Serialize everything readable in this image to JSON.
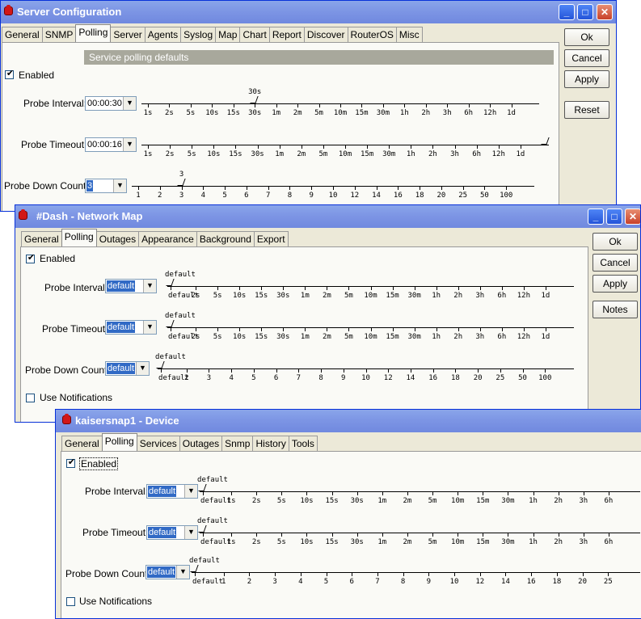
{
  "win1": {
    "title": "Server Configuration",
    "tabs": [
      "General",
      "SNMP",
      "Polling",
      "Server",
      "Agents",
      "Syslog",
      "Map",
      "Chart",
      "Report",
      "Discover",
      "RouterOS",
      "Misc"
    ],
    "active_tab": "Polling",
    "section": "Service polling defaults",
    "enabled_label": "Enabled",
    "buttons": {
      "ok": "Ok",
      "cancel": "Cancel",
      "apply": "Apply",
      "reset": "Reset"
    },
    "probe_interval": {
      "label": "Probe Interval:",
      "value": "00:00:30",
      "marker": "30s",
      "ticks": [
        "1s",
        "2s",
        "5s",
        "10s",
        "15s",
        "30s",
        "1m",
        "2m",
        "5m",
        "10m",
        "15m",
        "30m",
        "1h",
        "2h",
        "3h",
        "6h",
        "12h",
        "1d"
      ]
    },
    "probe_timeout": {
      "label": "Probe Timeout:",
      "value": "00:00:16",
      "ticks": [
        "1s",
        "2s",
        "5s",
        "10s",
        "15s",
        "30s",
        "1m",
        "2m",
        "5m",
        "10m",
        "15m",
        "30m",
        "1h",
        "2h",
        "3h",
        "6h",
        "12h",
        "1d"
      ]
    },
    "probe_down": {
      "label": "Probe Down Count:",
      "value": "3",
      "marker": "3",
      "ticks": [
        "1",
        "2",
        "3",
        "4",
        "5",
        "6",
        "7",
        "8",
        "9",
        "10",
        "12",
        "14",
        "16",
        "18",
        "20",
        "25",
        "50",
        "100"
      ]
    }
  },
  "win2": {
    "title": "#Dash - Network Map",
    "tabs": [
      "General",
      "Polling",
      "Outages",
      "Appearance",
      "Background",
      "Export"
    ],
    "active_tab": "Polling",
    "enabled_label": "Enabled",
    "use_notifications": "Use Notifications",
    "buttons": {
      "ok": "Ok",
      "cancel": "Cancel",
      "apply": "Apply",
      "notes": "Notes"
    },
    "probe_interval": {
      "label": "Probe Interval:",
      "value": "default",
      "marker": "default",
      "ticks": [
        "default",
        "2s",
        "5s",
        "10s",
        "15s",
        "30s",
        "1m",
        "2m",
        "5m",
        "10m",
        "15m",
        "30m",
        "1h",
        "2h",
        "3h",
        "6h",
        "12h",
        "1d"
      ]
    },
    "probe_timeout": {
      "label": "Probe Timeout:",
      "value": "default",
      "marker": "default",
      "ticks": [
        "default",
        "2s",
        "5s",
        "10s",
        "15s",
        "30s",
        "1m",
        "2m",
        "5m",
        "10m",
        "15m",
        "30m",
        "1h",
        "2h",
        "3h",
        "6h",
        "12h",
        "1d"
      ]
    },
    "probe_down": {
      "label": "Probe Down Count:",
      "value": "default",
      "marker": "default",
      "ticks": [
        "default",
        "2",
        "3",
        "4",
        "5",
        "6",
        "7",
        "8",
        "9",
        "10",
        "12",
        "14",
        "16",
        "18",
        "20",
        "25",
        "50",
        "100"
      ]
    }
  },
  "win3": {
    "title": "kaisersnap1 - Device",
    "tabs": [
      "General",
      "Polling",
      "Services",
      "Outages",
      "Snmp",
      "History",
      "Tools"
    ],
    "active_tab": "Polling",
    "enabled_label": "Enabled",
    "use_notifications": "Use Notifications",
    "probe_interval": {
      "label": "Probe Interval:",
      "value": "default",
      "marker": "default",
      "ticks": [
        "default",
        "1s",
        "2s",
        "5s",
        "10s",
        "15s",
        "30s",
        "1m",
        "2m",
        "5m",
        "10m",
        "15m",
        "30m",
        "1h",
        "2h",
        "3h",
        "6h"
      ]
    },
    "probe_timeout": {
      "label": "Probe Timeout:",
      "value": "default",
      "marker": "default",
      "ticks": [
        "default",
        "1s",
        "2s",
        "5s",
        "10s",
        "15s",
        "30s",
        "1m",
        "2m",
        "5m",
        "10m",
        "15m",
        "30m",
        "1h",
        "2h",
        "3h",
        "6h"
      ]
    },
    "probe_down": {
      "label": "Probe Down Count:",
      "value": "default",
      "marker": "default",
      "ticks": [
        "default",
        "1",
        "2",
        "3",
        "4",
        "5",
        "6",
        "7",
        "8",
        "9",
        "10",
        "12",
        "14",
        "16",
        "18",
        "20",
        "25"
      ]
    }
  }
}
